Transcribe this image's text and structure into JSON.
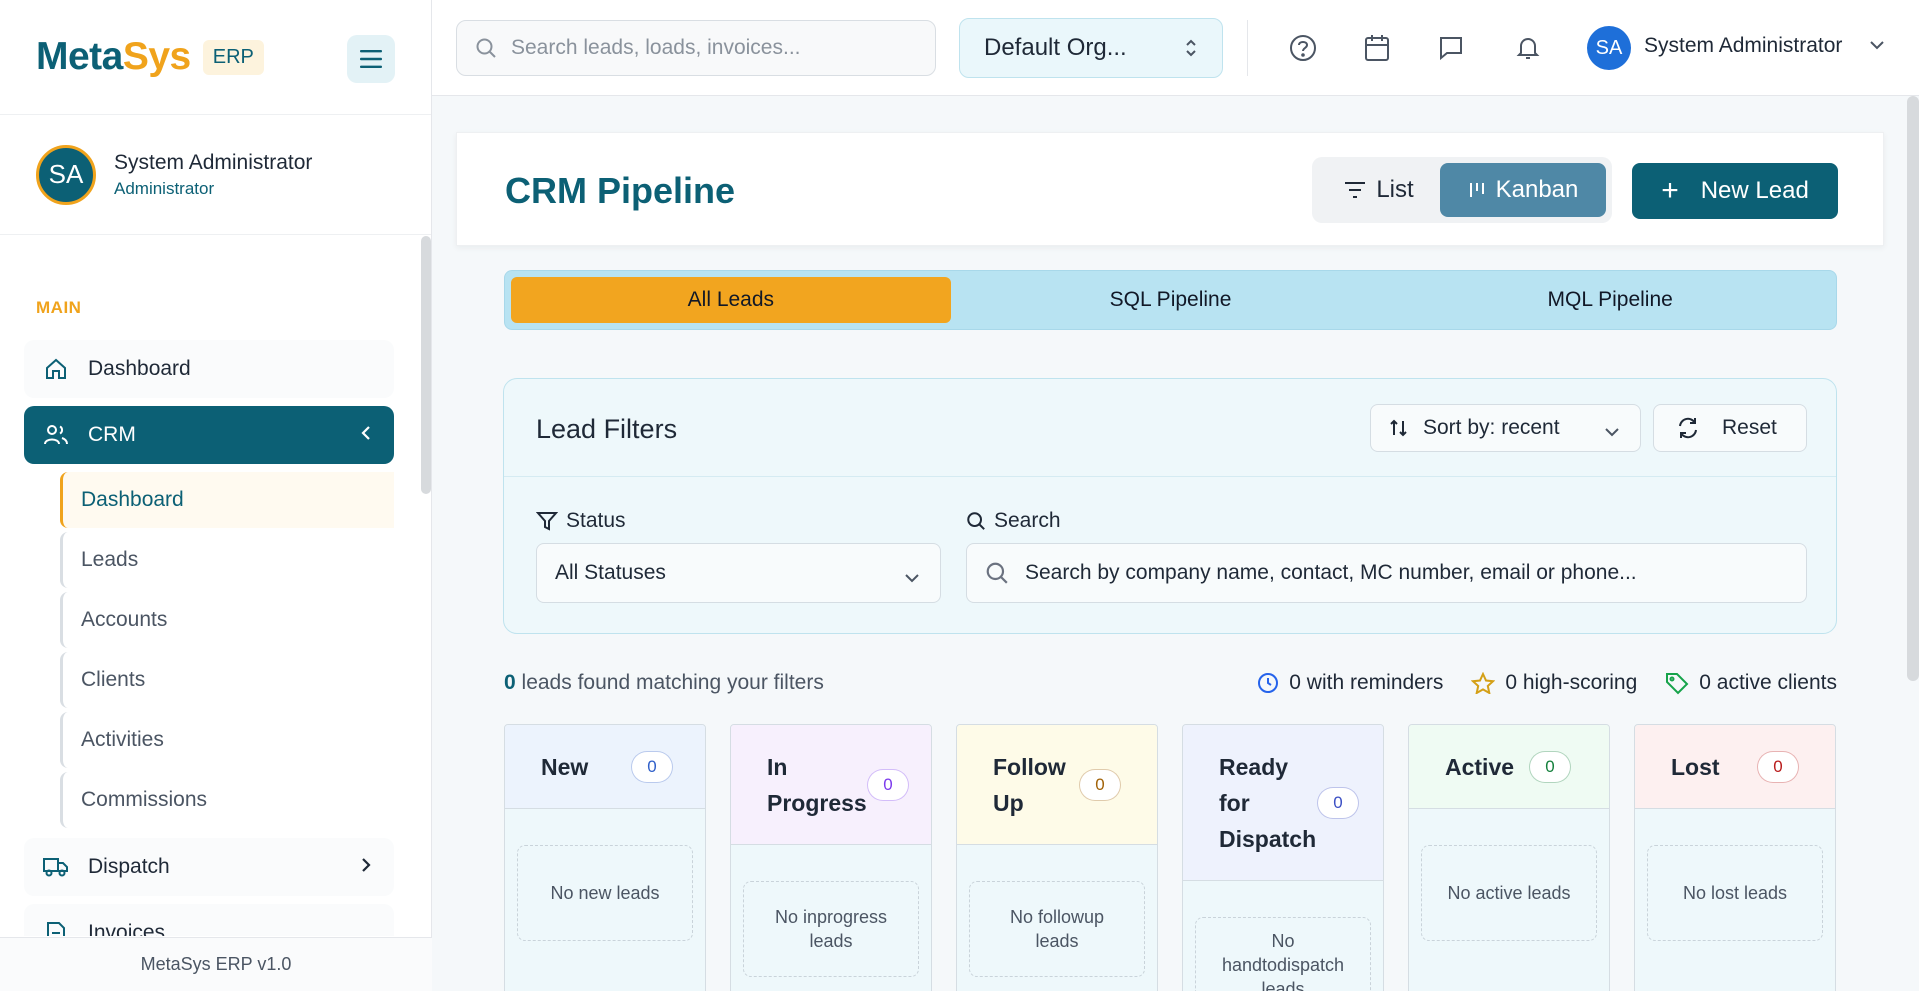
{
  "brand": {
    "name_part1": "Meta",
    "name_part2": "Sys",
    "badge": "ERP"
  },
  "sidebar_user": {
    "initials": "SA",
    "name": "System Administrator",
    "role": "Administrator"
  },
  "nav": {
    "section_label": "MAIN",
    "dashboard": "Dashboard",
    "crm": "CRM",
    "crm_sub": [
      "Dashboard",
      "Leads",
      "Accounts",
      "Clients",
      "Activities",
      "Commissions"
    ],
    "dispatch": "Dispatch",
    "invoices": "Invoices"
  },
  "footer": "MetaSys ERP v1.0",
  "topbar": {
    "search_placeholder": "Search leads, loads, invoices...",
    "org": "Default Org...",
    "user_initials": "SA",
    "user_name": "System Administrator"
  },
  "header": {
    "title": "CRM Pipeline",
    "list_label": "List",
    "kanban_label": "Kanban",
    "new_lead_label": "New Lead",
    "active_view": "Kanban"
  },
  "pipeline_tabs": [
    "All Leads",
    "SQL Pipeline",
    "MQL Pipeline"
  ],
  "filters": {
    "title": "Lead Filters",
    "sort_label": "Sort by: recent",
    "reset_label": "Reset",
    "status_label": "Status",
    "status_value": "All Statuses",
    "search_label": "Search",
    "search_placeholder": "Search by company name, contact, MC number, email or phone..."
  },
  "results": {
    "count": "0",
    "text": "leads found matching your filters",
    "reminders": "0 with reminders",
    "high_scoring": "0 high-scoring",
    "active_clients": "0 active clients"
  },
  "columns": [
    {
      "title": "New",
      "count": "0",
      "empty": "No new leads",
      "head_bg": "#ecf3fd",
      "badge_color": "#2f5fc9"
    },
    {
      "title": "In Progress",
      "count": "0",
      "empty": "No inprogress leads",
      "head_bg": "#f7f0fd",
      "badge_color": "#7c3aed"
    },
    {
      "title": "Follow Up",
      "count": "0",
      "empty": "No followup leads",
      "head_bg": "#fefbe8",
      "badge_color": "#a16207"
    },
    {
      "title": "Ready for Dispatch",
      "count": "0",
      "empty": "No handtodispatch leads",
      "head_bg": "#eef2fd",
      "badge_color": "#3b4fc4"
    },
    {
      "title": "Active",
      "count": "0",
      "empty": "No active leads",
      "head_bg": "#effbf3",
      "badge_color": "#15803d"
    },
    {
      "title": "Lost",
      "count": "0",
      "empty": "No lost leads",
      "head_bg": "#fdf0f0",
      "badge_color": "#b91c1c"
    }
  ],
  "colors": {
    "primary": "#0c6075",
    "accent": "#f0a31c",
    "kanban_active": "#4f88a6"
  }
}
